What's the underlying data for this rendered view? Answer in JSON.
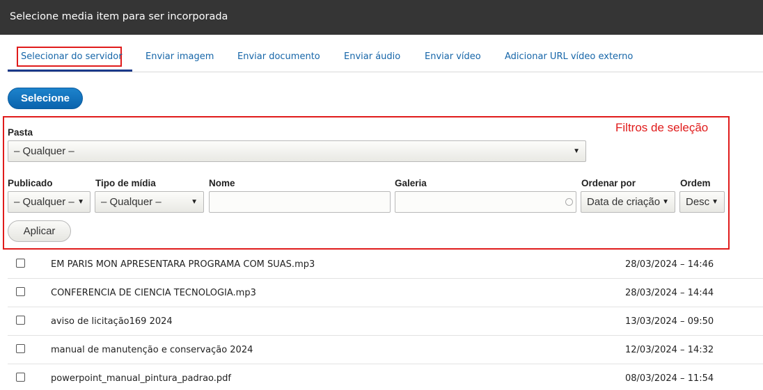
{
  "dialog": {
    "title": "Selecione media item para ser incorporada"
  },
  "tabs": [
    {
      "label": "Selecionar do servidor",
      "active": true
    },
    {
      "label": "Enviar imagem"
    },
    {
      "label": "Enviar documento"
    },
    {
      "label": "Enviar áudio"
    },
    {
      "label": "Enviar vídeo"
    },
    {
      "label": "Adicionar URL vídeo externo"
    }
  ],
  "select_button": {
    "label": "Selecione"
  },
  "filters": {
    "annotation": "Filtros de seleção",
    "pasta": {
      "label": "Pasta",
      "value": "– Qualquer –"
    },
    "publicado": {
      "label": "Publicado",
      "value": "– Qualquer –"
    },
    "tipo_midia": {
      "label": "Tipo de mídia",
      "value": "– Qualquer –"
    },
    "nome": {
      "label": "Nome",
      "value": ""
    },
    "galeria": {
      "label": "Galeria",
      "value": ""
    },
    "ordenar_por": {
      "label": "Ordenar por",
      "value": "Data de criação"
    },
    "ordem": {
      "label": "Ordem",
      "value": "Desc"
    },
    "apply_label": "Aplicar"
  },
  "media_items": [
    {
      "name": "EM PARIS MON APRESENTARA PROGRAMA COM SUAS.mp3",
      "date": "28/03/2024 – 14:46"
    },
    {
      "name": "CONFERENCIA DE CIENCIA TECNOLOGIA.mp3",
      "date": "28/03/2024 – 14:44"
    },
    {
      "name": "aviso de licitação169 2024",
      "date": "13/03/2024 – 09:50"
    },
    {
      "name": "manual de manutenção e conservação 2024",
      "date": "12/03/2024 – 14:32"
    },
    {
      "name": "powerpoint_manual_pintura_padrao.pdf",
      "date": "08/03/2024 – 11:54"
    }
  ],
  "colors": {
    "header_bg": "#353535",
    "tab_link": "#1565a8",
    "primary_button": "#0a63ad",
    "annotation_red": "#e01b1b"
  }
}
